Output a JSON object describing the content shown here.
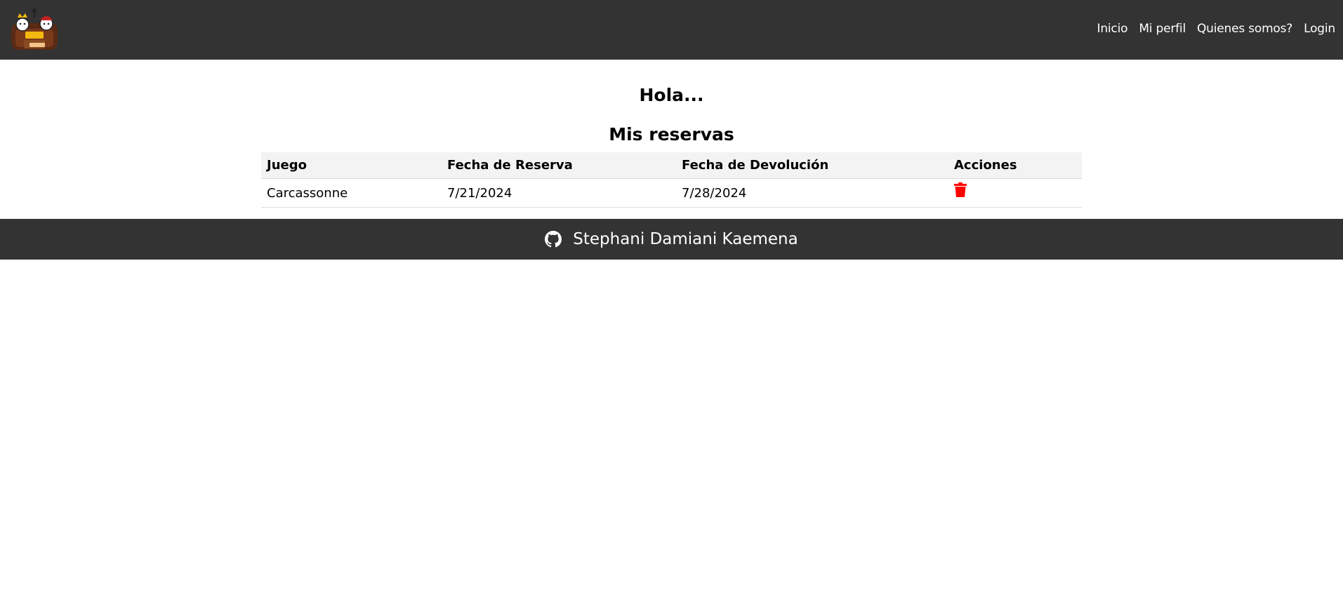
{
  "nav": {
    "logo_icon": "board-game-logo-icon",
    "links": [
      "Inicio",
      "Mi perfil",
      "Quienes somos?",
      "Login"
    ]
  },
  "main": {
    "greeting": "Hola...",
    "section_title": "Mis reservas",
    "table": {
      "headers": [
        "Juego",
        "Fecha de Reserva",
        "Fecha de Devolución",
        "Acciones"
      ],
      "rows": [
        {
          "juego": "Carcassonne",
          "fecha_reserva": "7/21/2024",
          "fecha_devolucion": "7/28/2024",
          "action_icon": "trash-icon"
        }
      ]
    }
  },
  "footer": {
    "icon": "github-icon",
    "author": "Stephani Damiani Kaemena"
  },
  "colors": {
    "header_bg": "#333333",
    "footer_bg": "#333333",
    "table_header_bg": "#f3f3f3",
    "delete_icon": "#ff0000"
  }
}
